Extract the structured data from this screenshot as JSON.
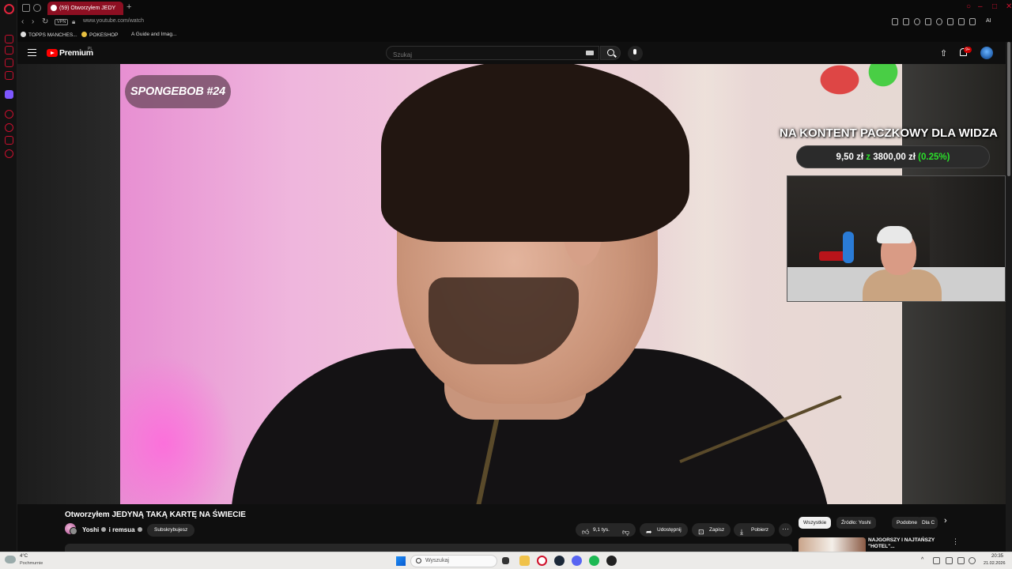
{
  "browser": {
    "tab_title": "(59) Otworzyłem JEDY",
    "new_tab": "+",
    "vpn_label": "VPN",
    "url": "www.youtube.com/watch",
    "ai_label": "AI",
    "window_controls": [
      "–",
      "□",
      "✕"
    ]
  },
  "bookmarks": [
    {
      "label": "TOPPS MANCHES..."
    },
    {
      "label": "POKESHOP"
    },
    {
      "label": "A Guide and Imag..."
    }
  ],
  "youtube": {
    "brand": "Premium",
    "region": "PL",
    "search_placeholder": "Szukaj",
    "notifications": "9+"
  },
  "video_overlay": {
    "badge": "SPONGEBOB #24",
    "kontent_title": "NA KONTENT PACZKOWY DLA WIDZA",
    "kontent_current": "9,50 zł",
    "kontent_of": "z",
    "kontent_goal": "3800,00 zł",
    "kontent_percent": "(0.25%)",
    "progress_fraction": 0.0025
  },
  "video": {
    "title": "Otworzyłem JEDYNĄ TAKĄ KARTĘ NA ŚWIECIE",
    "channel": "Yoshi",
    "channel_sep": "i",
    "channel2": "remsua",
    "subscribe_label": "Subskrybujesz",
    "likes": "9,1 tys.",
    "share_label": "Udostępnij",
    "save_label": "Zapisz",
    "download_label": "Pobierz",
    "more_label": "···"
  },
  "chips": [
    {
      "label": "Wszystkie",
      "selected": true
    },
    {
      "label": "Źródło: Yoshi",
      "selected": false
    },
    {
      "label": "Podobne",
      "selected": false
    },
    {
      "label": "Dla C",
      "selected": false
    }
  ],
  "recommendation": {
    "title": "NAJGORSZY I NAJTAŃSZY \"HOTEL\"..."
  },
  "taskbar": {
    "temperature": "4°C",
    "weather": "Pochmurnie",
    "search_placeholder": "Wyszukaj",
    "time": "20:35",
    "date": "21.02.2026"
  }
}
